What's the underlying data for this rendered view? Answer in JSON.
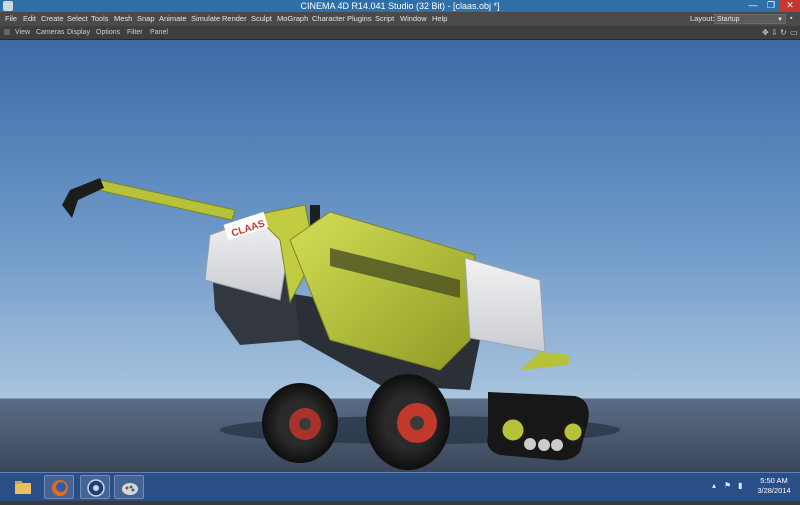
{
  "window": {
    "title": "CINEMA 4D R14.041 Studio (32 Bit) - [claas.obj *]",
    "controls": {
      "minimize": "—",
      "maximize": "❐",
      "close": "✕"
    }
  },
  "menubar": {
    "items": [
      "File",
      "Edit",
      "Create",
      "Select",
      "Tools",
      "Mesh",
      "Snap",
      "Animate",
      "Simulate",
      "Render",
      "Sculpt",
      "MoGraph",
      "Character",
      "Plugins",
      "Script",
      "Window",
      "Help"
    ],
    "layout_label": "Layout:",
    "layout_value": "Startup"
  },
  "viewport_menu": {
    "items": [
      "View",
      "Cameras",
      "Display",
      "Options",
      "Filter",
      "Panel"
    ],
    "nav_icons": [
      "move-view-icon",
      "zoom-view-icon",
      "rotate-view-icon",
      "maximize-view-icon"
    ]
  },
  "viewport": {
    "logo_text": "CLAAS",
    "colors": {
      "machine": "#b9c63c",
      "sky_top": "#3c6aa6",
      "horizon": "#a8c4de",
      "floor": "#4c5c74",
      "rim": "#c0392b"
    }
  },
  "taskbar": {
    "apps": [
      "file-explorer-icon",
      "firefox-icon",
      "cinema4d-icon",
      "paint-icon"
    ],
    "time": "5:50 AM",
    "date": "3/28/2014"
  }
}
